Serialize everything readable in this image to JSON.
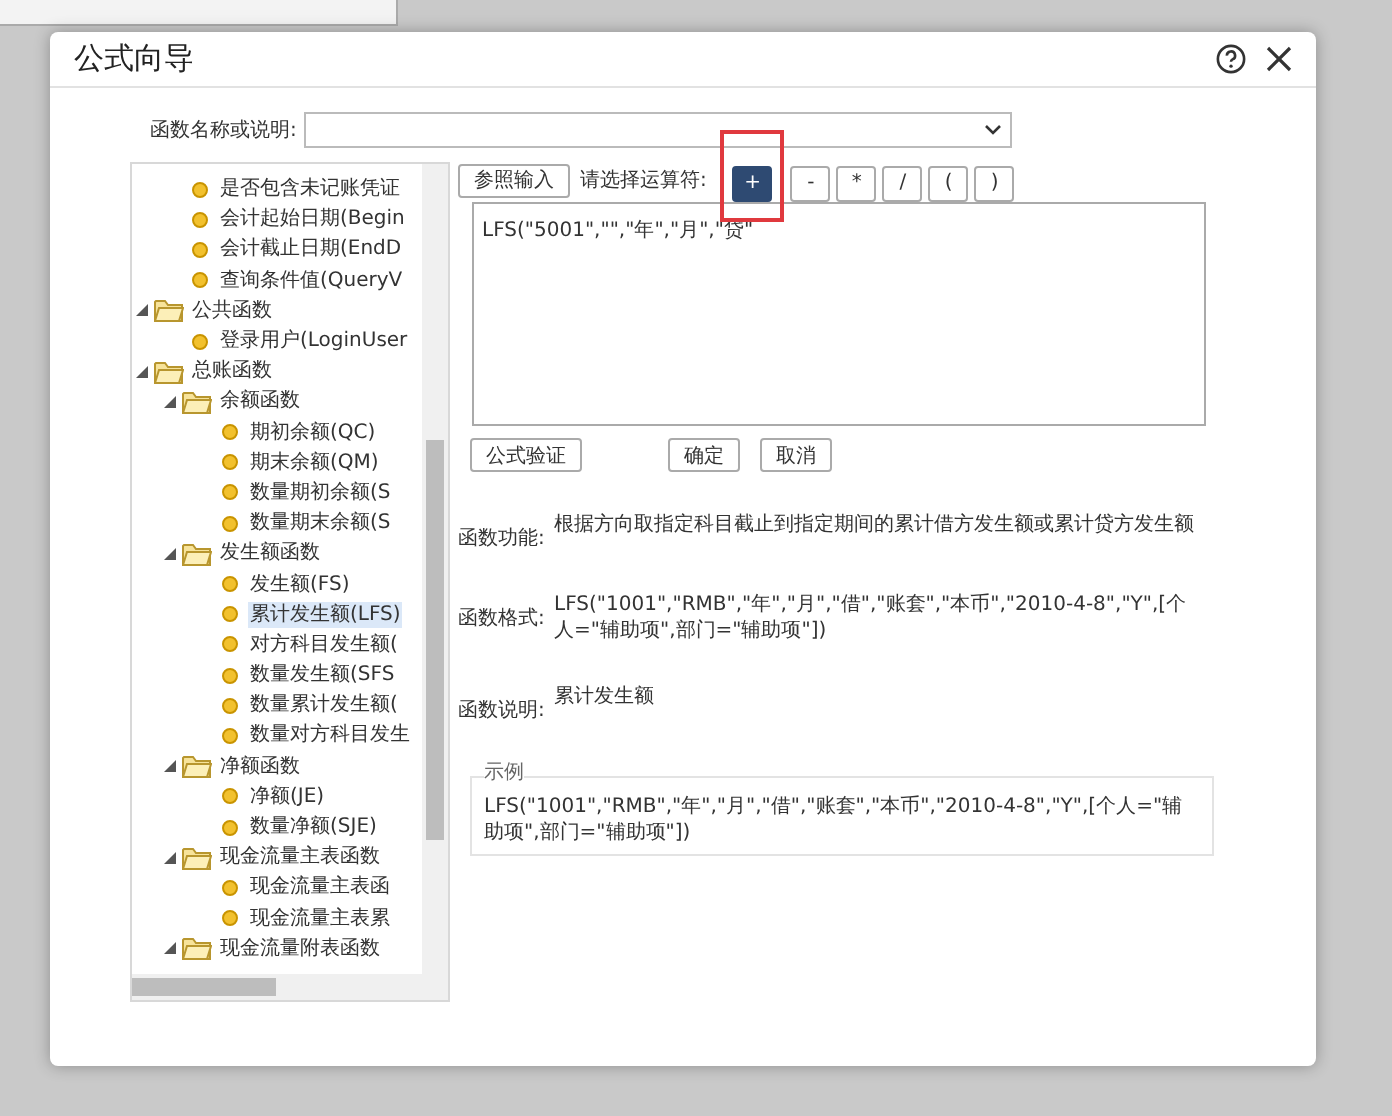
{
  "window": {
    "title": "公式向导"
  },
  "search": {
    "label": "函数名称或说明:"
  },
  "tree": {
    "items": [
      {
        "children": [
          {
            "label": "是否包含未记账凭证"
          },
          {
            "label": "会计起始日期(Begin"
          },
          {
            "label": "会计截止日期(EndD"
          },
          {
            "label": "查询条件值(QueryV"
          }
        ]
      },
      {
        "label": "公共函数",
        "expanded": true,
        "children": [
          {
            "label": "登录用户(LoginUser"
          }
        ]
      },
      {
        "label": "总账函数",
        "expanded": true,
        "children": [
          {
            "label": "余额函数",
            "expanded": true,
            "children": [
              {
                "label": "期初余额(QC)"
              },
              {
                "label": "期末余额(QM)"
              },
              {
                "label": "数量期初余额(S"
              },
              {
                "label": "数量期末余额(S"
              }
            ]
          },
          {
            "label": "发生额函数",
            "expanded": true,
            "children": [
              {
                "label": "发生额(FS)",
                "selected": false
              },
              {
                "label": "累计发生额(LFS)",
                "selected": true
              },
              {
                "label": "对方科目发生额("
              },
              {
                "label": "数量发生额(SFS"
              },
              {
                "label": "数量累计发生额("
              },
              {
                "label": "数量对方科目发生"
              }
            ]
          },
          {
            "label": "净额函数",
            "expanded": true,
            "children": [
              {
                "label": "净额(JE)"
              },
              {
                "label": "数量净额(SJE)"
              }
            ]
          },
          {
            "label": "现金流量主表函数",
            "expanded": true,
            "children": [
              {
                "label": "现金流量主表函"
              },
              {
                "label": "现金流量主表累"
              }
            ]
          },
          {
            "label": "现金流量附表函数",
            "expanded": true
          }
        ]
      }
    ]
  },
  "reference_button": "参照输入",
  "operator_label": "请选择运算符:",
  "operators": [
    {
      "label": "+",
      "selected": true,
      "highlighted": true
    },
    {
      "label": "-",
      "selected": false,
      "highlighted": false
    },
    {
      "label": "*",
      "selected": false,
      "highlighted": false
    },
    {
      "label": "/",
      "selected": false,
      "highlighted": false
    },
    {
      "label": "(",
      "selected": false,
      "highlighted": false
    },
    {
      "label": ")",
      "selected": false,
      "highlighted": false
    }
  ],
  "formula": "LFS(\"5001\",\"\",\"年\",\"月\",\"贷\"",
  "buttons": [
    "公式验证",
    "确定",
    "取消"
  ],
  "info": [
    {
      "label": "函数功能:",
      "text": "根据方向取指定科目截止到指定期间的累计借方发生额或累计贷方发生额"
    },
    {
      "label": "函数格式:",
      "text": "LFS(\"1001\",\"RMB\",\"年\",\"月\",\"借\",\"账套\",\"本币\",\"2010-4-8\",\"Y\",[个人=\"辅助项\",部门=\"辅助项\"])"
    },
    {
      "label": "函数说明:",
      "text": "累计发生额"
    }
  ],
  "example": {
    "title": "示例",
    "text": "LFS(\"1001\",\"RMB\",\"年\",\"月\",\"借\",\"账套\",\"本币\",\"2010-4-8\",\"Y\",[个人=\"辅助项\",部门=\"辅助项\"])"
  }
}
